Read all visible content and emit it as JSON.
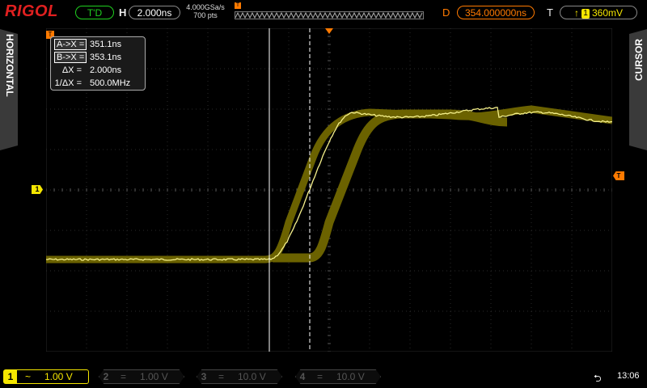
{
  "header": {
    "brand": "RIGOL",
    "trigger_status": "T'D",
    "horizontal_label": "H",
    "timebase": "2.000ns",
    "sample_rate": "4.000GSa/s",
    "memory_depth": "700 pts",
    "delay_label": "D",
    "delay": "354.000000ns",
    "trigger_label": "T",
    "trigger_source": "1",
    "trigger_level": "360mV"
  },
  "side_tabs": {
    "left": "HORIZONTAL",
    "right": "CURSOR"
  },
  "cursor_readout": {
    "a_label": "A->X =",
    "a_value": "351.1ns",
    "b_label": "B->X =",
    "b_value": "353.1ns",
    "dx_label": "ΔX =",
    "dx_value": "2.000ns",
    "inv_label": "1/ΔX =",
    "inv_value": "500.0MHz"
  },
  "markers": {
    "trigger_position": "T",
    "channel1": "1",
    "trigger_level": "T"
  },
  "channels": [
    {
      "num": "1",
      "coupling": "~",
      "scale": "1.00 V",
      "active": true
    },
    {
      "num": "2",
      "coupling": "=",
      "scale": "1.00 V",
      "active": false
    },
    {
      "num": "3",
      "coupling": "=",
      "scale": "10.0 V",
      "active": false
    },
    {
      "num": "4",
      "coupling": "=",
      "scale": "10.0 V",
      "active": false
    }
  ],
  "status": {
    "usb_icon": "usb-icon",
    "time": "13:06"
  },
  "colors": {
    "ch1": "#f5e600",
    "trigger": "#ff7a00",
    "status_ok": "#1fd01f",
    "brand": "#e02020"
  }
}
